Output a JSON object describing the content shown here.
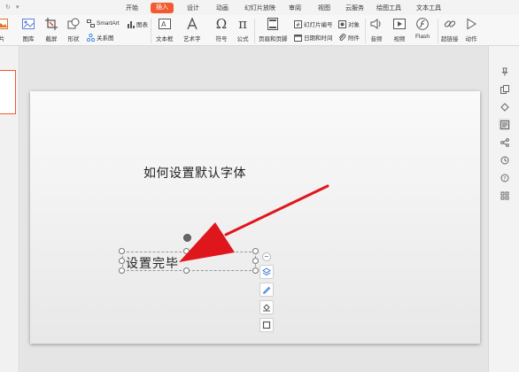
{
  "tabs": [
    {
      "label": "开始",
      "active": false
    },
    {
      "label": "插入",
      "active": true
    },
    {
      "label": "设计",
      "active": false
    },
    {
      "label": "动画",
      "active": false
    },
    {
      "label": "幻灯片放映",
      "active": false
    },
    {
      "label": "审阅",
      "active": false
    },
    {
      "label": "视图",
      "active": false
    },
    {
      "label": "云服务",
      "active": false
    },
    {
      "label": "绘图工具",
      "active": false
    },
    {
      "label": "文本工具",
      "active": false
    }
  ],
  "ribbon": {
    "picture_label": "片",
    "gallery_label": "图库",
    "screenshot_label": "截屏",
    "shape_label": "形状",
    "smartart_label": "SmartArt",
    "chart_label": "图表",
    "relation_label": "关系图",
    "textbox_label": "文本框",
    "wordart_label": "艺术字",
    "symbol_label": "符号",
    "formula_label": "公式",
    "header_footer_label": "页眉和页脚",
    "slide_number_label": "幻灯片编号",
    "object_label": "对象",
    "datetime_label": "日期和时间",
    "attachment_label": "附件",
    "audio_label": "音频",
    "video_label": "视频",
    "flash_label": "Flash",
    "hyperlink_label": "超链接",
    "action_label": "动作"
  },
  "slide": {
    "title_text": "如何设置默认字体",
    "textbox_text": "设置完毕"
  },
  "colors": {
    "accent": "#f05b31",
    "arrow": "#e0161d"
  }
}
